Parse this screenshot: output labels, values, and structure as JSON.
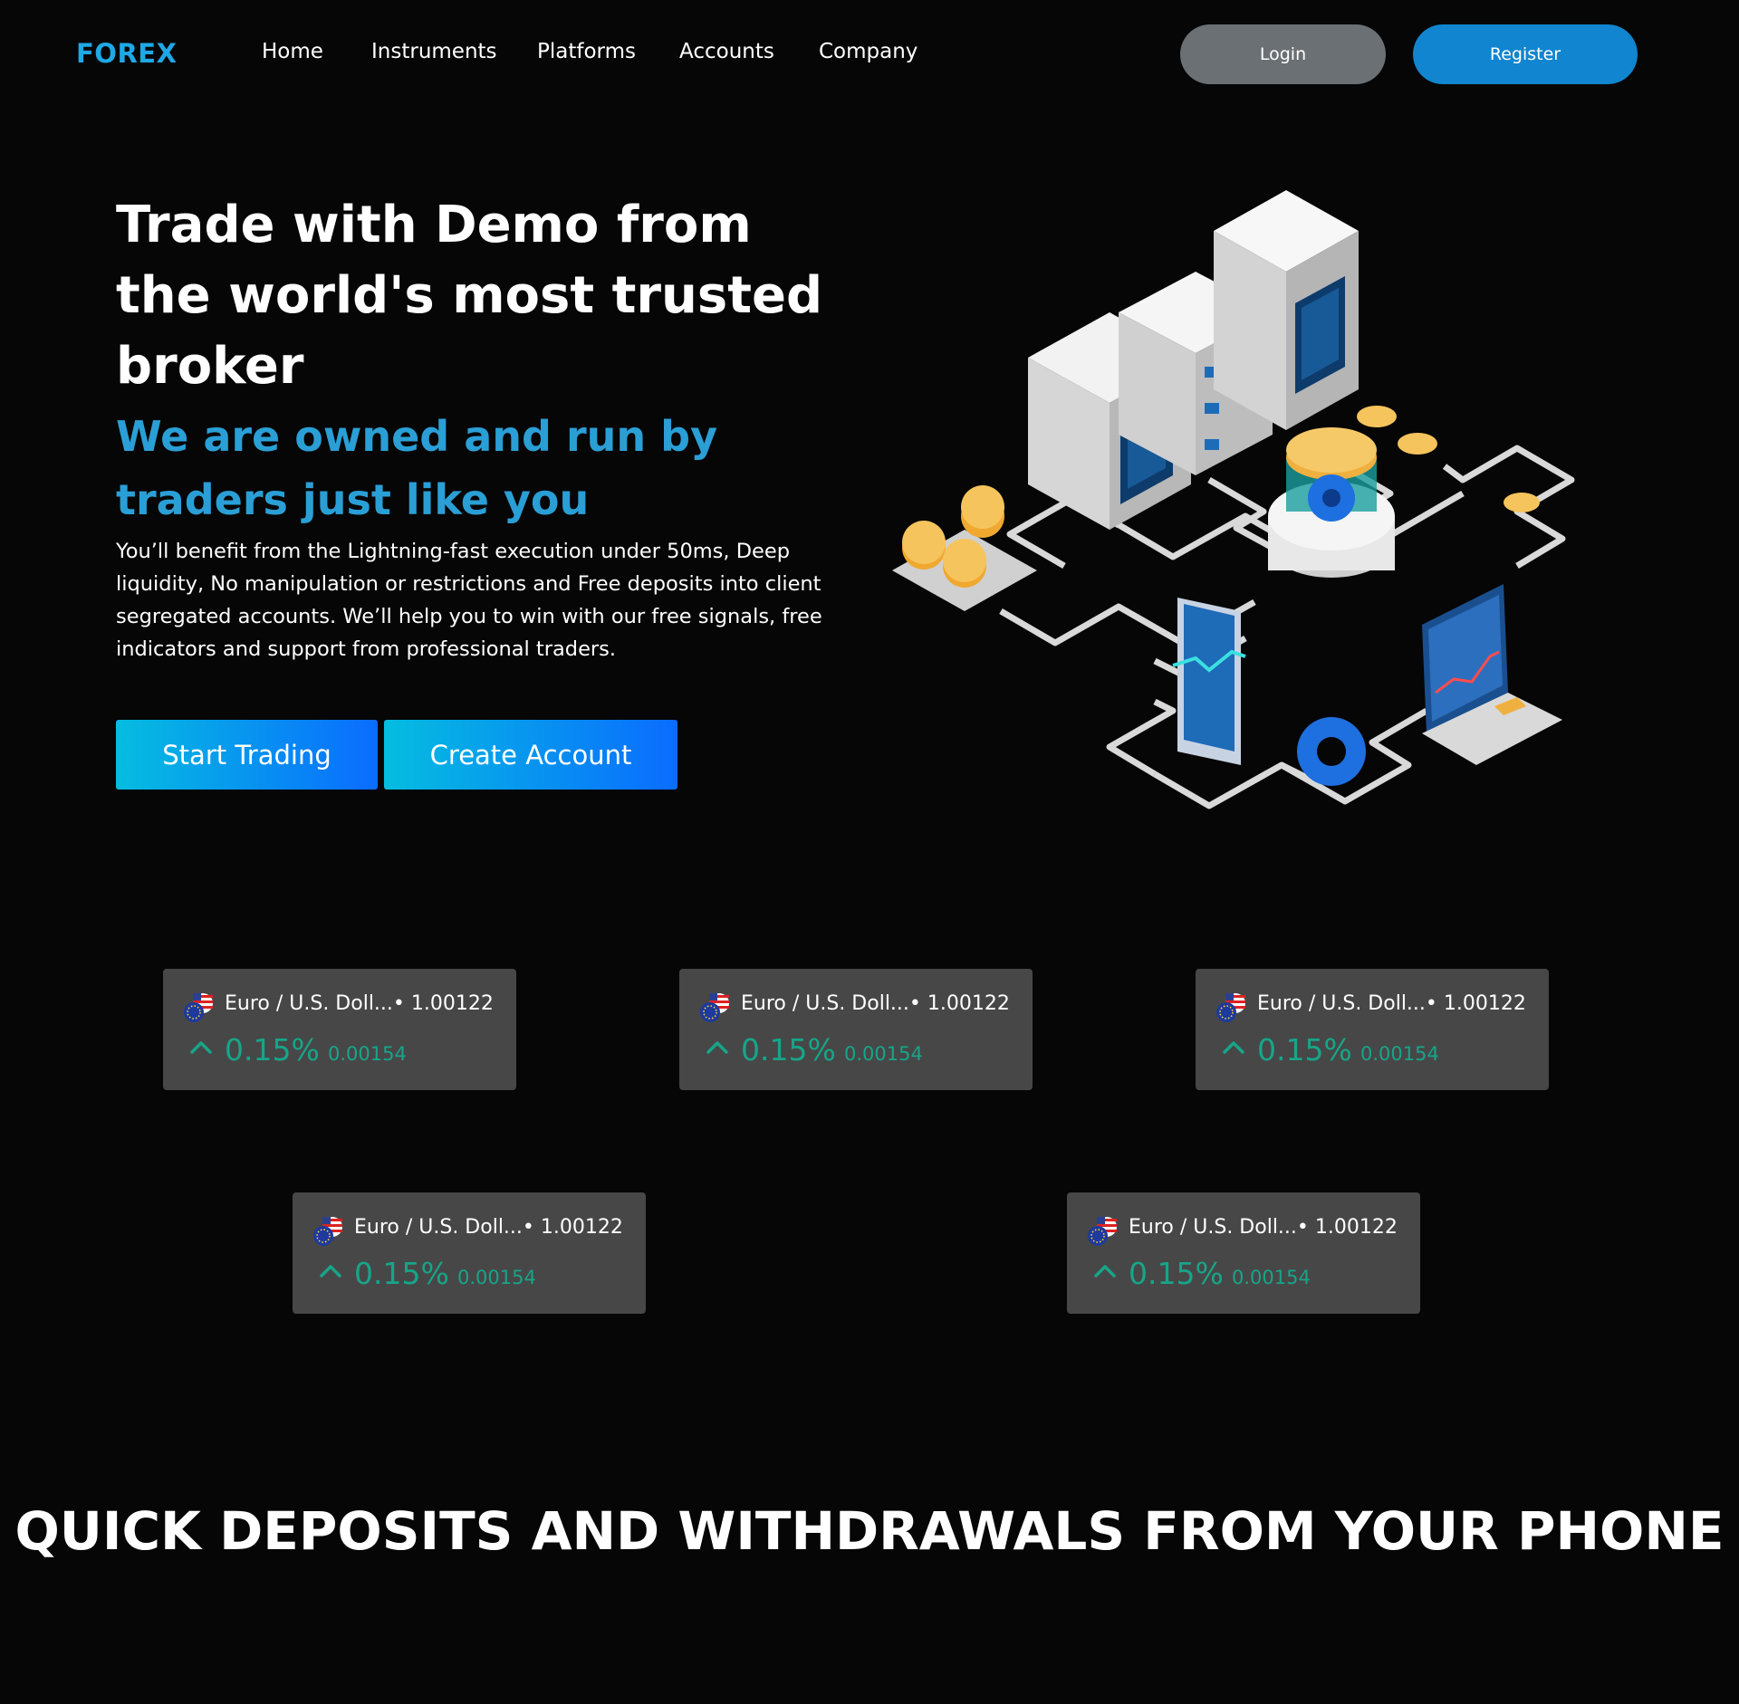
{
  "colors": {
    "background": "#060606",
    "brand": "#1fa8e6",
    "accent_heading": "#2a9fd6",
    "login_bg": "#6b7074",
    "register_bg": "#1185cf",
    "cta_gradient_start": "#05bde0",
    "cta_gradient_end": "#0a6cff",
    "ticker_bg": "#474747",
    "ticker_positive": "#17a589"
  },
  "nav": {
    "logo": "FOREX",
    "links": [
      "Home",
      "Instruments",
      "Platforms",
      "Accounts",
      "Company"
    ],
    "login_label": "Login",
    "register_label": "Register"
  },
  "hero": {
    "title": "Trade with Demo from the world's most trusted broker",
    "subtitle": "We are owned and run by traders just like you",
    "description": "You’ll benefit from the Lightning-fast execution under 50ms, Deep liquidity, No manipulation or restrictions and Free deposits into client segregated accounts. We’ll help you to win with our free signals, free indicators and support from professional traders.",
    "start_trading_label": "Start Trading",
    "create_account_label": "Create Account",
    "illustration_icon": "server-network-illustration"
  },
  "tickers": [
    {
      "pair": "Euro  /  U.S. Doll...• 1.00122",
      "change_pct": "0.15%",
      "change_abs": "0.00154",
      "flag_icon": "eur-usd-flag-icon",
      "direction_icon": "arrow-up-icon"
    },
    {
      "pair": "Euro  /  U.S. Doll...• 1.00122",
      "change_pct": "0.15%",
      "change_abs": "0.00154",
      "flag_icon": "eur-usd-flag-icon",
      "direction_icon": "arrow-up-icon"
    },
    {
      "pair": "Euro  /  U.S. Doll...• 1.00122",
      "change_pct": "0.15%",
      "change_abs": "0.00154",
      "flag_icon": "eur-usd-flag-icon",
      "direction_icon": "arrow-up-icon"
    },
    {
      "pair": "Euro  /  U.S. Doll...• 1.00122",
      "change_pct": "0.15%",
      "change_abs": "0.00154",
      "flag_icon": "eur-usd-flag-icon",
      "direction_icon": "arrow-up-icon"
    },
    {
      "pair": "Euro  /  U.S. Doll...• 1.00122",
      "change_pct": "0.15%",
      "change_abs": "0.00154",
      "flag_icon": "eur-usd-flag-icon",
      "direction_icon": "arrow-up-icon"
    }
  ],
  "section": {
    "title": "QUICK DEPOSITS AND WITHDRAWALS FROM YOUR PHONE"
  }
}
